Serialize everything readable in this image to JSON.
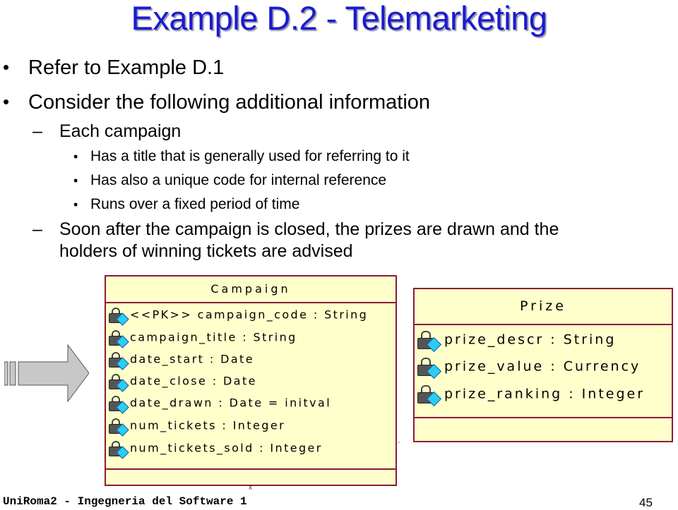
{
  "slide": {
    "title": "Example D.2 - Telemarketing",
    "bullets": [
      {
        "level": 1,
        "marker": "•",
        "text": "Refer to Example D.1"
      },
      {
        "level": 1,
        "marker": "•",
        "text": "Consider the following additional information"
      },
      {
        "level": 2,
        "marker": "–",
        "text": "Each campaign"
      },
      {
        "level": 3,
        "marker": "•",
        "text": "Has a title that is generally used for referring to it"
      },
      {
        "level": 3,
        "marker": "•",
        "text": "Has also a unique code for internal reference"
      },
      {
        "level": 3,
        "marker": "•",
        "text": "Runs over a fixed period of time"
      },
      {
        "level": 2,
        "marker": "–",
        "text": "Soon after the campaign is closed, the prizes are drawn and the"
      },
      {
        "level": 2,
        "marker": "",
        "text": "holders of winning tickets are advised"
      }
    ],
    "footer": "UniRoma2 - Ingegneria del Software 1",
    "page_number": "45"
  },
  "diagram": {
    "arrow_icon": "block-arrow-right-icon",
    "classes": [
      {
        "name": "Campaign",
        "attributes": [
          "<<PK>> campaign_code : String",
          "campaign_title : String",
          "date_start : Date",
          "date_close : Date",
          "date_drawn : Date = initval",
          "num_tickets : Integer",
          "num_tickets_sold : Integer"
        ]
      },
      {
        "name": "Prize",
        "attributes": [
          "prize_descr : String",
          "prize_value : Currency",
          "prize_ranking : Integer"
        ]
      }
    ],
    "colors": {
      "class_fill": "#ffffcc",
      "class_border": "#8b1a3a",
      "title_color": "#1a1ad0",
      "attribute_icon_diamond": "#2ecbf2",
      "arrow_fill": "#c8c8c8"
    }
  }
}
